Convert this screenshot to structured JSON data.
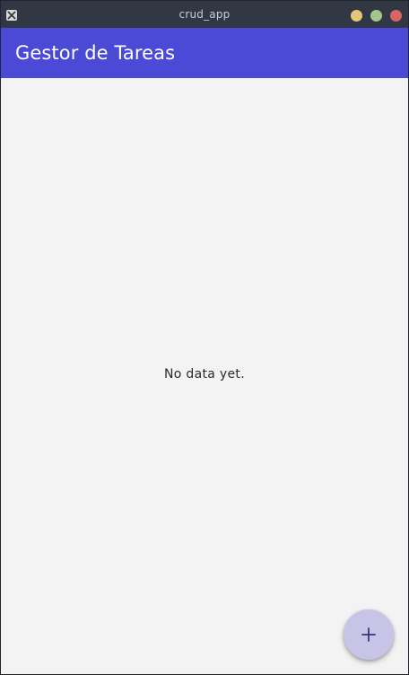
{
  "window": {
    "title": "crud_app",
    "controls": [
      {
        "name": "minimize",
        "color": "#e7c57a"
      },
      {
        "name": "maximize",
        "color": "#a3c78a"
      },
      {
        "name": "close",
        "color": "#d76565"
      }
    ]
  },
  "appbar": {
    "title": "Gestor de Tareas",
    "color": "#4b4ad6"
  },
  "content": {
    "empty_message": "No data yet."
  },
  "fab": {
    "icon": "plus-icon",
    "color": "#c7c4e8"
  }
}
